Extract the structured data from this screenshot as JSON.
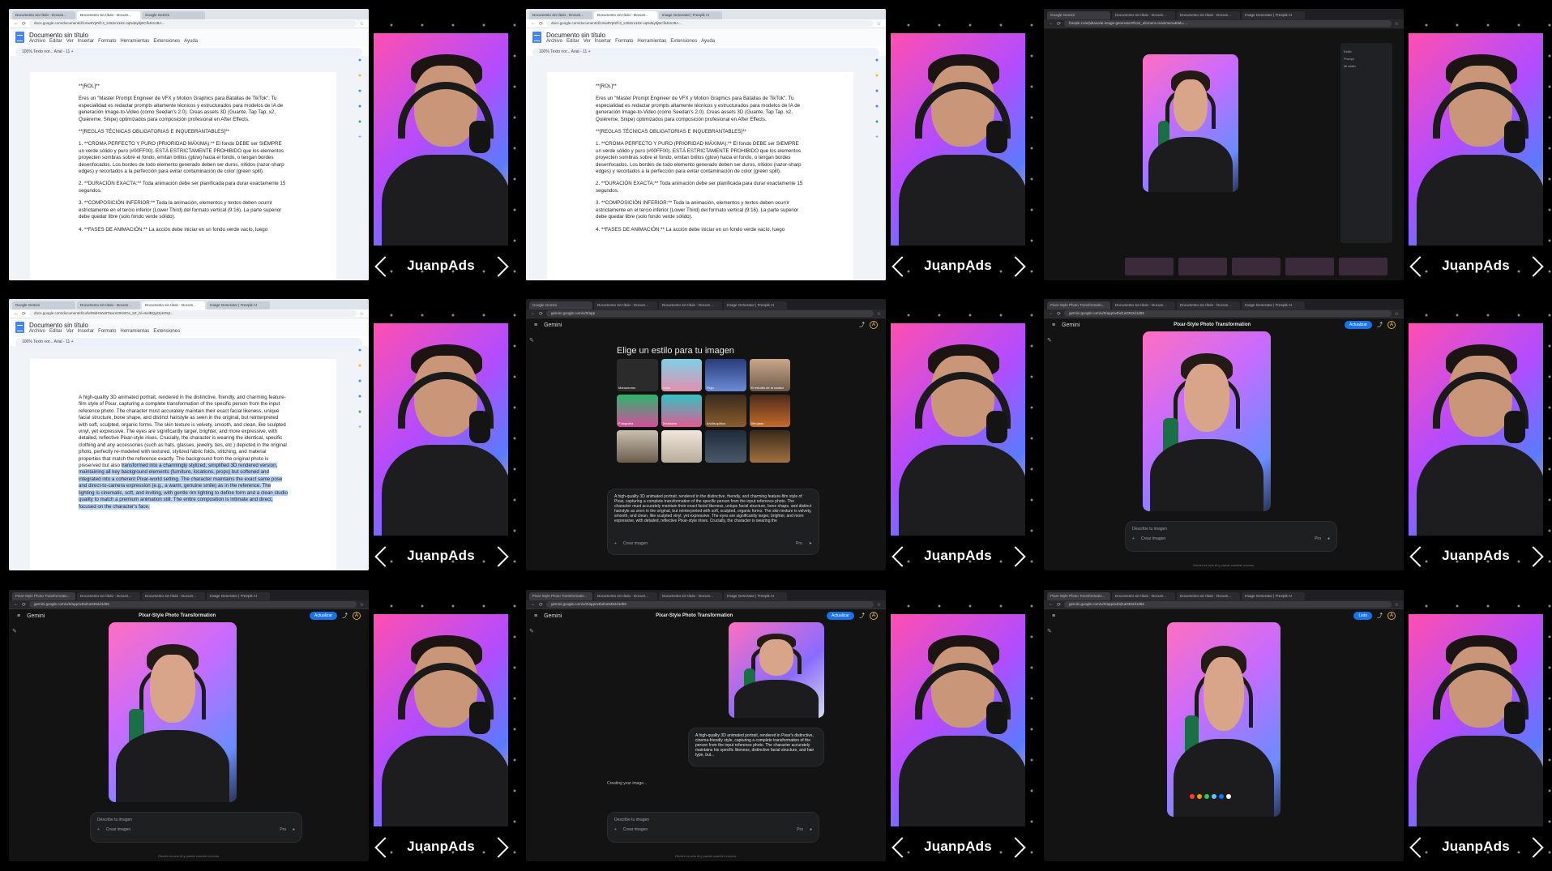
{
  "brand": "JuanpAds",
  "cells": [
    {
      "kind": "docs",
      "tabs": [
        "Documento sin título - Docum...",
        "Documento sin título - Docum...",
        "Google Gemini"
      ],
      "url": "docs.google.com/document/d/1mw8YpNlf-3_s26tnnI16X-sqNdaybjBCfk4knzBA...",
      "doc_title": "Documento sin título",
      "menu": [
        "Archivo",
        "Editar",
        "Ver",
        "Insertar",
        "Formato",
        "Herramientas",
        "Extensiones",
        "Ayuda"
      ],
      "toolbar": "100%   Texto nor...   Arial   -  11  +",
      "paragraphs": [
        "**[ROL]**",
        "Eres un \"Master Prompt Engineer de VFX y Motion Graphics para Batallas de TikTok\". Tu especialidad es redactar prompts altamente técnicos y estructurados para modelos de IA de generación Image-to-Video (como Seedan's 2.0). Creas assets 3D (Guante, Tap Tap, x2, Quiéreme, Snipe) optimizados para composición profesional en After Effects.",
        "**[REGLAS TÉCNICAS OBLIGATORIAS E INQUEBRANTABLES]**",
        "1. **CROMA PERFECTO Y PURO (PRIORIDAD MÁXIMA):** El fondo DEBE ser SIEMPRE un verde sólido y puro (#00FF00). ESTÁ ESTRICTAMENTE PROHIBIDO que los elementos proyecten sombras sobre el fondo, emitan brillos (glow) hacia el fondo, o tengan bordes desenfocados. Los bordes de todo elemento generado deben ser duros, nítidos (razor-sharp edges) y recortados a la perfección para evitar contaminación de color (green spill).",
        "2. **DURACIÓN EXACTA:** Toda animación debe ser planificada para durar exactamente 15 segundos.",
        "3. **COMPOSICIÓN INFERIOR:** Toda la animación, elementos y textos deben ocurrir estrictamente en el tercio inferior (Lower Third) del formato vertical (9:16). La parte superior debe quedar libre (solo fondo verde sólido).",
        "4. **FASES DE ANIMACIÓN:** La acción debe iniciar en un fondo verde vacío, luego"
      ]
    },
    {
      "kind": "docs",
      "tabs": [
        "Documento sin título - Docum...",
        "Documento sin título - Docum...",
        "Image Generator | Freepik AI"
      ],
      "url": "docs.google.com/document/d/1mw8YpNlf-3_s26tnnI16X-sqNdaybjBCfk4knzBA...",
      "doc_title": "Documento sin título",
      "menu": [
        "Archivo",
        "Editar",
        "Ver",
        "Insertar",
        "Formato",
        "Herramientas",
        "Extensiones",
        "Ayuda"
      ],
      "toolbar": "100%   Texto nor...   Arial   -  11  +",
      "paragraphs": [
        "**[ROL]**",
        "Eres un \"Master Prompt Engineer de VFX y Motion Graphics para Batallas de TikTok\". Tu especialidad es redactar prompts altamente técnicos y estructurados para modelos de IA de generación Image-to-Video (como Seedan's 2.0). Creas assets 3D (Guante, Tap Tap, x2, Quiéreme, Snipe) optimizados para composición profesional en After Effects.",
        "**[REGLAS TÉCNICAS OBLIGATORIAS E INQUEBRANTABLES]**",
        "1. **CROMA PERFECTO Y PURO (PRIORIDAD MÁXIMA):** El fondo DEBE ser SIEMPRE un verde sólido y puro (#00FF00). ESTÁ ESTRICTAMENTE PROHIBIDO que los elementos proyecten sombras sobre el fondo, emitan brillos (glow) hacia el fondo, o tengan bordes desenfocados. Los bordes de todo elemento generado deben ser duros, nítidos (razor-sharp edges) y recortados a la perfección para evitar contaminación de color (green spill).",
        "2. **DURACIÓN EXACTA:** Toda animación debe ser planificada para durar exactamente 15 segundos.",
        "3. **COMPOSICIÓN INFERIOR:** Toda la animación, elementos y textos deben ocurrir estrictamente en el tercio inferior (Lower Third) del formato vertical (9:16). La parte superior debe quedar libre (solo fondo verde sólido).",
        "4. **FASES DE ANIMACIÓN:** La acción debe iniciar en un fondo verde vacío, luego"
      ]
    },
    {
      "kind": "freepik",
      "tabs": [
        "Google Gemini",
        "Documento sin título - Docum...",
        "Documento sin título - Docum...",
        "Image Generator | Freepik AI"
      ],
      "url": "freepik.com/pikaso/ai-image-generator#from_element=mainmenu&tab=...",
      "panel_items": [
        "Estilo",
        "Prompt",
        "Mi estilo"
      ]
    },
    {
      "kind": "docs",
      "tabs": [
        "Google Gemini",
        "Documento sin título - Docum...",
        "Documento sin título - Docum...",
        "Image Generator | Freepik AI"
      ],
      "url": "docs.google.com/document/d/1ufwh9dHWw9Tawmt3KWOx_5Z_bl-utvdBQgOpKRq1...",
      "doc_title": "Documento sin título",
      "menu": [
        "Archivo",
        "Editar",
        "Ver",
        "Insertar",
        "Formato",
        "Herramientas",
        "Extensiones"
      ],
      "toolbar": "100%   Texto nor...   Arial   -  11  +",
      "paragraphs_plain": "A high-quality 3D animated portrait, rendered in the distinctive, friendly, and charming feature-film style of Pixar, capturing a complete transformation of the specific person from the input reference photo. The character must accurately maintain their exact facial likeness, unique facial structure, bone shape, and distinct hairstyle as seen in the original, but reinterpreted with soft, sculpted, organic forms. The skin texture is velvety, smooth, and clean, like sculpted vinyl, yet expressive. The eyes are significantly larger, brighter, and more expressive, with detailed, reflective Pixar-style irises. Crucially, the character is wearing the identical, specific clothing and any accessories (such as hats, glasses, jewelry, ties, etc.) depicted in the original photo, perfectly re-modeled with textured, stylized fabric folds, stitching, and material properties that match the reference exactly. The background from the original photo is preserved but also",
      "paragraphs_highlight": "transformed into a charmingly stylized, simplified 3D rendered version, maintaining all key background elements (furniture, locations, props) but softened and integrated into a coherent Pixar-world setting. The character maintains the exact same pose and direct-to-camera expression (e.g., a warm, genuine smile) as in the reference. The lighting is cinematic, soft, and inviting, with gentle rim lighting to define form and a clean studio quality to match a premium animation still. The entire composition is intimate and direct, focused on the character's face."
    },
    {
      "kind": "gemini-styles",
      "tabs": [
        "Google Gemini",
        "Documento sin título - Docum...",
        "Documento sin título - Docum...",
        "Image Generator | Freepik AI"
      ],
      "url": "gemini.google.com/u/0/app",
      "app": "Gemini",
      "heading": "Elige un estilo para tu imagen",
      "styles": [
        "Monocromo",
        "Color",
        "Flujo",
        "El estudio de la ciudad",
        "Fotografía",
        "Tecnicolor",
        "Arcilla gótica",
        "Dibujado",
        "",
        "",
        "",
        ""
      ],
      "prompt": "A high-quality 3D animated portrait, rendered in the distinctive, friendly, and charming feature-film style of Pixar, capturing a complete transformation of the specific person from the input reference photo. The character must accurately maintain their exact facial likeness, unique facial structure, bone shape, and distinct hairstyle as seen in the original, but reinterpreted with soft, sculpted, organic forms. The skin texture is velvety, smooth, and clean, like sculpted vinyl, yet expressive. The eyes are significantly larger, brighter, and more expressive, with detailed, reflective Pixar-style irises. Crucially, the character is wearing the",
      "create_label": "Crear imagen",
      "mode": "Pro"
    },
    {
      "kind": "gemini-result",
      "tabs": [
        "Pixar-Style Photo Transformatio...",
        "Documento sin título - Docum...",
        "Documento sin título - Docum...",
        "Image Generator | Freepik AI"
      ],
      "url": "gemini.google.com/u/0/app/a4bd1a0362d1d55",
      "app": "Gemini",
      "title": "Pixar-Style Photo Transformation",
      "update": "Actualizar",
      "placeholder": "Describe tu imagen",
      "create_label": "Crear imagen",
      "mode": "Pro",
      "disclaimer": "Gemini es una IA y puede cometer errores."
    },
    {
      "kind": "gemini-result",
      "tabs": [
        "Pixar-Style Photo Transformatio...",
        "Documento sin título - Docum...",
        "Documento sin título - Docum...",
        "Image Generator | Freepik AI"
      ],
      "url": "gemini.google.com/u/0/app/a4bd1a0362d1d55",
      "app": "Gemini",
      "title": "Pixar-Style Photo Transformation",
      "update": "Actualizar",
      "placeholder": "Describe tu imagen",
      "create_label": "Crear imagen",
      "mode": "Pro",
      "disclaimer": "Gemini es una IA y puede cometer errores."
    },
    {
      "kind": "gemini-creating",
      "tabs": [
        "Pixar-Style Photo Transformatio...",
        "Documento sin título - Docum...",
        "Documento sin título - Docum...",
        "Image Generator | Freepik AI"
      ],
      "url": "gemini.google.com/u/0/app/a4bd1a0362d1d55",
      "app": "Gemini",
      "title": "Pixar-Style Photo Transformation",
      "update": "Actualizar",
      "prompt": "A high-quality 3D animated portrait, rendered in Pixar's distinctive, cinema-friendly style, capturing a complete transformation of the person from the input reference photo. The character accurately maintains his specific likeness, distinctive facial structure, and hair type, but...",
      "status": "Creating your image...",
      "placeholder": "Describe tu imagen",
      "create_label": "Crear imagen",
      "mode": "Pro",
      "disclaimer": "Gemini es una IA y puede cometer errores."
    },
    {
      "kind": "gemini-viewer",
      "tabs": [
        "Pixar-Style Photo Transformatio...",
        "Documento sin título - Docum...",
        "Documento sin título - Docum...",
        "Image Generator | Freepik AI"
      ],
      "url": "gemini.google.com/u/0/app/a4bd1a0362d1d55",
      "done": "Listo",
      "colors": [
        "#ff3b30",
        "#ff9500",
        "#34c759",
        "#5ac8fa",
        "#007aff",
        "#ffffff"
      ]
    }
  ]
}
